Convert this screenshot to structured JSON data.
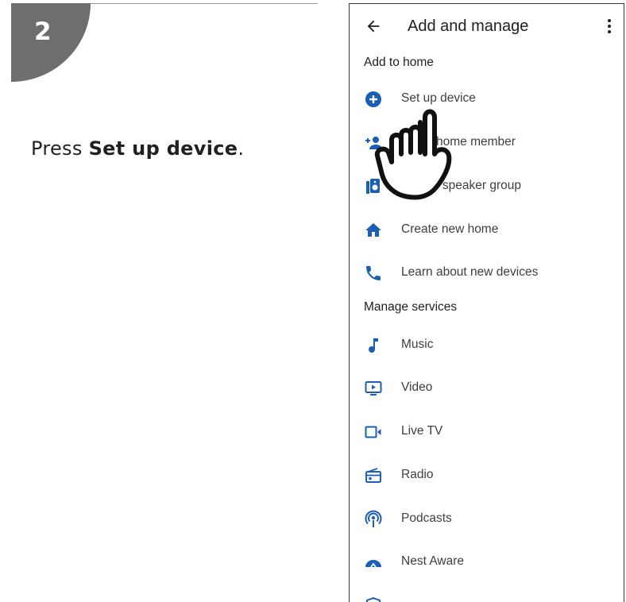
{
  "step": {
    "number": "2",
    "instruction_prefix": "Press ",
    "instruction_bold": "Set up device",
    "instruction_suffix": "."
  },
  "app": {
    "title": "Add and manage",
    "sections": [
      {
        "header": "Add to home",
        "items": [
          {
            "label": "Set up device",
            "icon": "add-circle-icon"
          },
          {
            "label": "home member",
            "icon": "add-person-icon"
          },
          {
            "label": "e speaker group",
            "icon": "speaker-group-icon"
          },
          {
            "label": "Create new home",
            "icon": "home-icon"
          },
          {
            "label": "Learn about new devices",
            "icon": "phone-icon"
          }
        ]
      },
      {
        "header": "Manage services",
        "items": [
          {
            "label": "Music",
            "icon": "music-note-icon"
          },
          {
            "label": "Video",
            "icon": "video-icon"
          },
          {
            "label": "Live TV",
            "icon": "live-tv-icon"
          },
          {
            "label": "Radio",
            "icon": "radio-icon"
          },
          {
            "label": "Podcasts",
            "icon": "podcasts-icon"
          },
          {
            "label": "Nest Aware",
            "icon": "nest-aware-icon"
          }
        ]
      }
    ]
  },
  "colors": {
    "icon_blue": "#1a5fb4",
    "badge_gray": "#6d6e70"
  }
}
